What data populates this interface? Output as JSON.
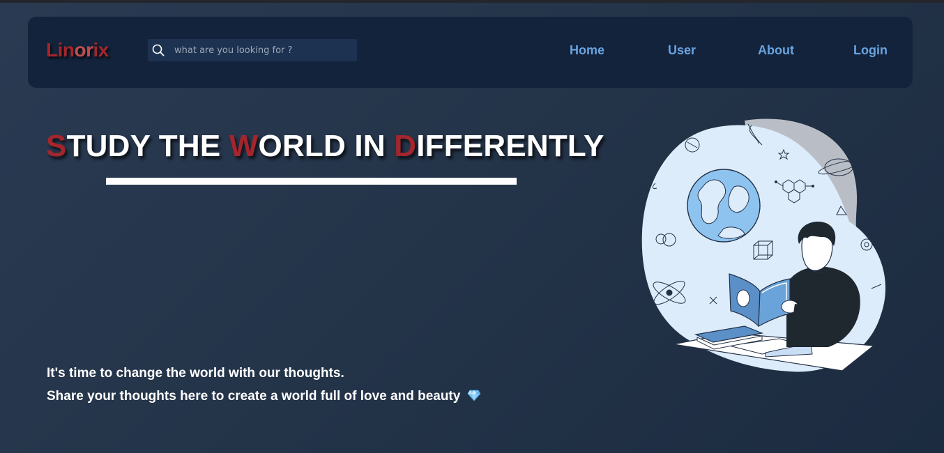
{
  "navbar": {
    "logo": {
      "part1": "Lin",
      "part2": "or",
      "part3": "ix"
    },
    "search": {
      "placeholder": "what are you looking for ?",
      "icon": "search-icon"
    },
    "links": [
      {
        "label": "Home"
      },
      {
        "label": "User"
      },
      {
        "label": "About"
      },
      {
        "label": "Login"
      }
    ]
  },
  "hero": {
    "headline": {
      "w1_first": "S",
      "w1_rest": "TUDY THE ",
      "w2_first": "W",
      "w2_rest": "ORLD IN ",
      "w3_first": "D",
      "w3_rest": "IFFERENTLY"
    },
    "line1": "It's time to change the world with our thoughts.",
    "line2": "Share your thoughts here to create a world full of love and beauty",
    "emoji": "gem-icon"
  },
  "colors": {
    "accent_red": "#a3262c",
    "link_blue": "#6aa3e0",
    "navbar_bg": "#13233b",
    "page_bg": "#243449"
  }
}
